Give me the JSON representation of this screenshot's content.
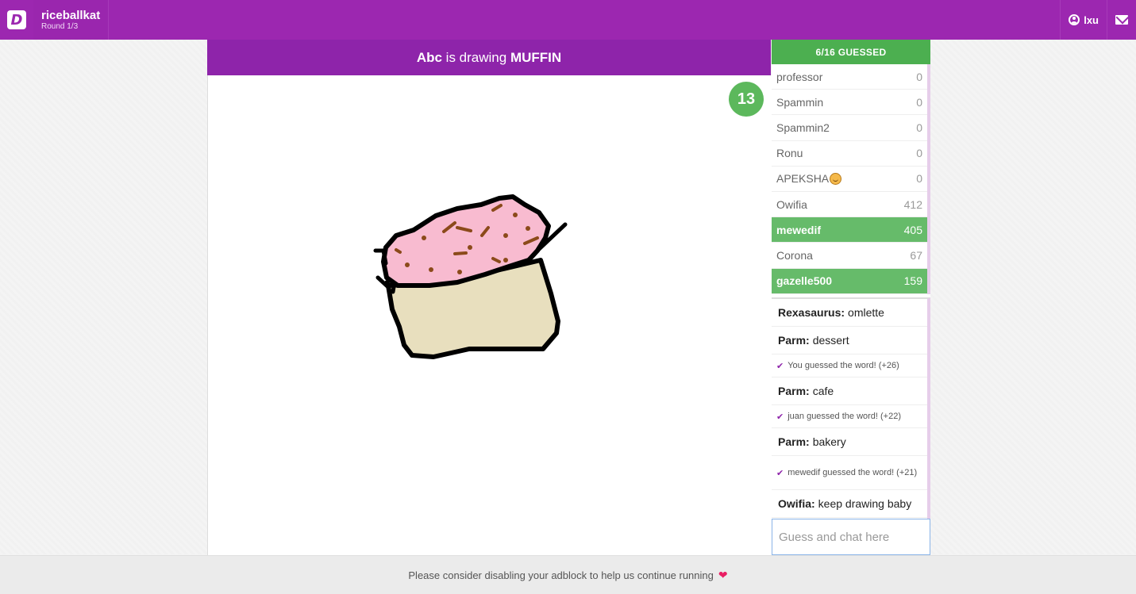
{
  "app": {
    "logo_letter": "D",
    "room_name": "riceballkat",
    "round_text": "Round 1/3",
    "username": "lxu"
  },
  "game": {
    "drawer": "Abc",
    "drawing_text": "is drawing",
    "word": "MUFFIN",
    "timer": "13"
  },
  "guessed_count": "6/16 GUESSED",
  "players": [
    {
      "name": "professor",
      "score": "0",
      "guessed": false
    },
    {
      "name": "Spammin",
      "score": "0",
      "guessed": false
    },
    {
      "name": "Spammin2",
      "score": "0",
      "guessed": false
    },
    {
      "name": "Ronu",
      "score": "0",
      "guessed": false
    },
    {
      "name": "APEKSHA",
      "score": "0",
      "guessed": false,
      "emoji": "smiley-icon"
    },
    {
      "name": "Owifia",
      "score": "412",
      "guessed": false
    },
    {
      "name": "mewedif",
      "score": "405",
      "guessed": true
    },
    {
      "name": "Corona",
      "score": "67",
      "guessed": false
    },
    {
      "name": "gazelle500",
      "score": "159",
      "guessed": true
    }
  ],
  "chat": [
    {
      "type": "user",
      "user": "Rexasaurus:",
      "text": "omlette"
    },
    {
      "type": "user",
      "user": "Parm:",
      "text": "dessert"
    },
    {
      "type": "system",
      "text": "You guessed the word! (+26)"
    },
    {
      "type": "user",
      "user": "Parm:",
      "text": "cafe"
    },
    {
      "type": "system",
      "text": "juan guessed the word! (+22)"
    },
    {
      "type": "user",
      "user": "Parm:",
      "text": "bakery"
    },
    {
      "type": "system",
      "text": "mewedif guessed the word! (+21)"
    },
    {
      "type": "user",
      "user": "Owifia:",
      "text": "keep drawing baby"
    }
  ],
  "chat_input_placeholder": "Guess and chat here",
  "footer_text": "Please consider disabling your adblock to help us continue running",
  "colors": {
    "brand": "#9c27b0",
    "guessed": "#66bb6a",
    "timer": "#5cb85c",
    "frosting": "#f8bbd0",
    "cake": "#e8dfbe",
    "sprinkles": "#8b4a1a"
  }
}
